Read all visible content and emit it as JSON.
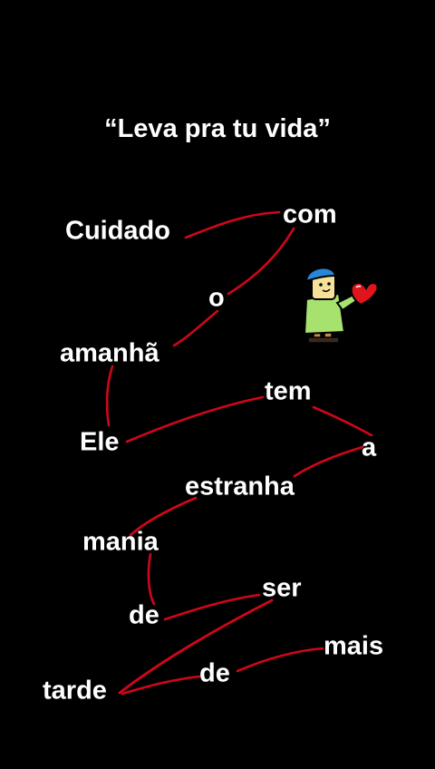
{
  "title": "“Leva pra tu vida”",
  "words": [
    "Cuidado",
    "com",
    "o",
    "amanhã",
    "Ele",
    "tem",
    "a",
    "estranha",
    "mania",
    "de",
    "ser",
    "tarde",
    "de",
    "mais"
  ],
  "colors": {
    "background": "#000000",
    "text": "#ffffff",
    "line": "#d0061a"
  },
  "sticker_icon": "person-holding-heart"
}
